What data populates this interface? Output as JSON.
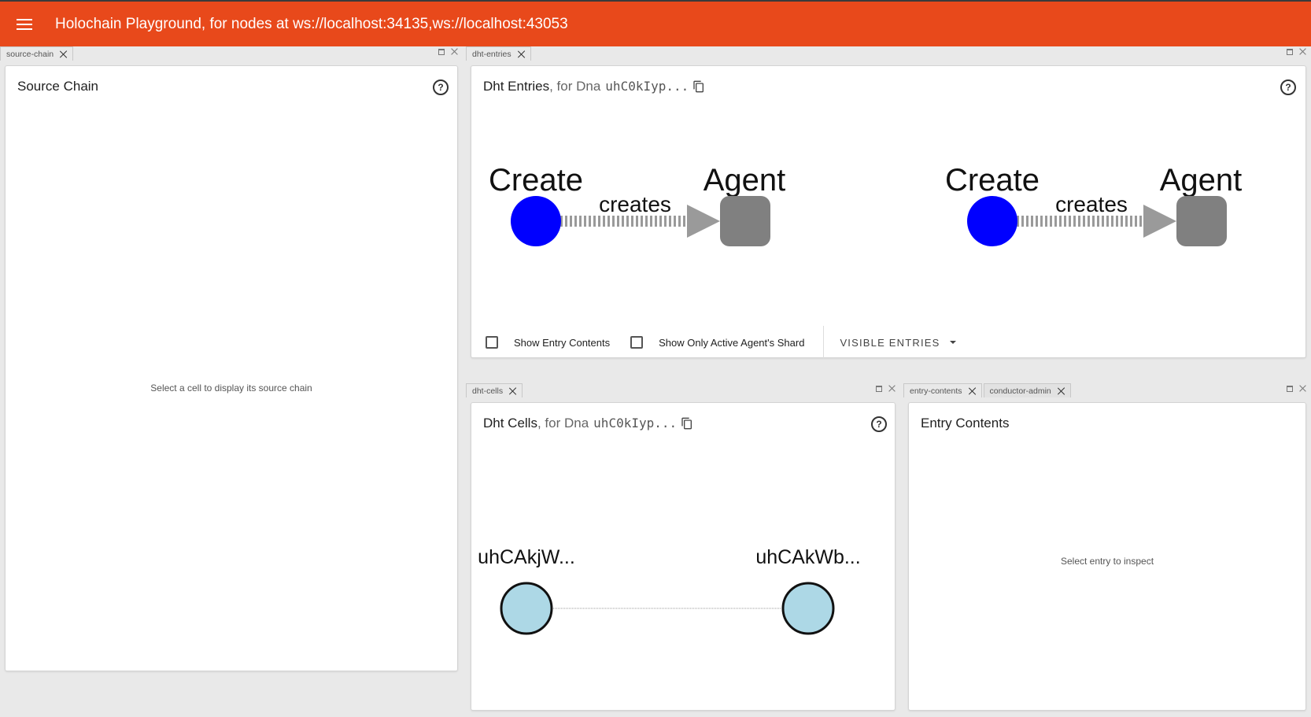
{
  "app": {
    "title": "Holochain Playground, for nodes at ws://localhost:34135,ws://localhost:43053",
    "accent_color": "#e8491b",
    "menu_icon": "menu-icon"
  },
  "panes": {
    "source_chain": {
      "tab_label": "source-chain",
      "title": "Source Chain",
      "placeholder": "Select a cell to display its source chain"
    },
    "dht_entries": {
      "tab_label": "dht-entries",
      "title": "Dht Entries",
      "title_suffix": ", for Dna",
      "dna_hash": "uhC0kIyp...",
      "graph": [
        {
          "source_label": "Create",
          "edge_label": "creates",
          "target_label": "Agent",
          "source_color": "#0000ff",
          "target_color": "#808080"
        },
        {
          "source_label": "Create",
          "edge_label": "creates",
          "target_label": "Agent",
          "source_color": "#0000ff",
          "target_color": "#808080"
        }
      ],
      "show_entry_contents_label": "Show Entry Contents",
      "show_only_active_label": "Show Only Active Agent's Shard",
      "visible_entries_label": "VISIBLE ENTRIES"
    },
    "dht_cells": {
      "tab_label": "dht-cells",
      "title": "Dht Cells",
      "title_suffix": ", for Dna",
      "dna_hash": "uhC0kIyp...",
      "nodes": [
        {
          "label": "uhCAkjW..."
        },
        {
          "label": "uhCAkWb..."
        }
      ],
      "node_color": "#add8e6"
    },
    "entry_contents": {
      "tab_label": "entry-contents",
      "second_tab_label": "conductor-admin",
      "title": "Entry Contents",
      "placeholder": "Select entry to inspect"
    }
  }
}
